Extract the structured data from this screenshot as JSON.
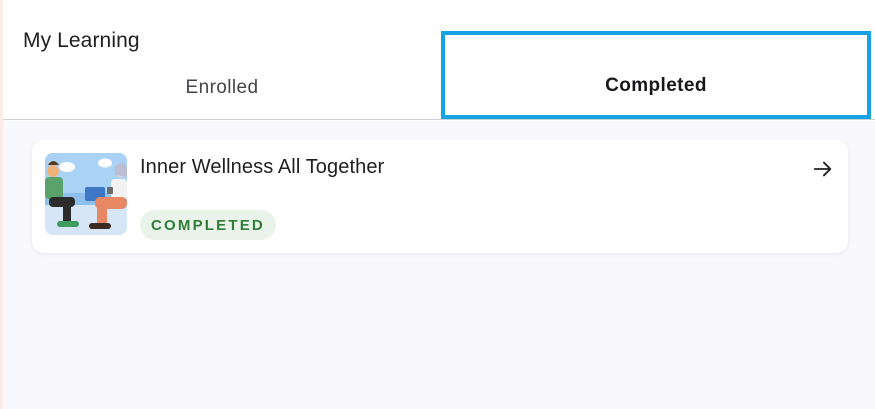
{
  "header": {
    "title": "My Learning",
    "tabs": [
      {
        "label": "Enrolled",
        "selected": false
      },
      {
        "label": "Completed",
        "selected": true
      }
    ]
  },
  "courses": [
    {
      "title": "Inner Wellness All Together",
      "status": "COMPLETED",
      "thumbnail_icon": "wellness-illustration",
      "action_icon": "arrow-right-icon"
    }
  ],
  "colors": {
    "selected_tab_outline": "#16a3e6",
    "badge_background": "#e9f3ea",
    "badge_text": "#2f7d36",
    "content_background": "#f9f8fd"
  }
}
